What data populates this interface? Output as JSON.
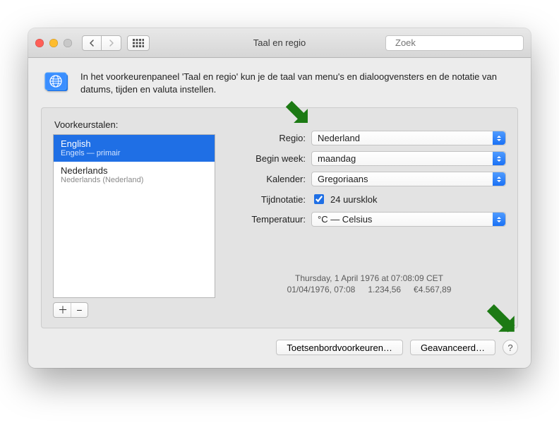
{
  "window": {
    "title": "Taal en regio",
    "search_placeholder": "Zoek"
  },
  "intro": {
    "text": "In het voorkeurenpaneel 'Taal en regio' kun je de taal van menu's en dialoogvensters en de notatie van datums, tijden en valuta instellen."
  },
  "languages": {
    "heading": "Voorkeurstalen:",
    "items": [
      {
        "name": "English",
        "sub": "Engels — primair",
        "selected": true
      },
      {
        "name": "Nederlands",
        "sub": "Nederlands (Nederland)",
        "selected": false
      }
    ]
  },
  "settings": {
    "region": {
      "label": "Regio:",
      "value": "Nederland"
    },
    "weekstart": {
      "label": "Begin week:",
      "value": "maandag"
    },
    "calendar": {
      "label": "Kalender:",
      "value": "Gregoriaans"
    },
    "timefmt": {
      "label": "Tijdnotatie:",
      "checkbox_label": "24 uursklok",
      "checked": true
    },
    "temperature": {
      "label": "Temperatuur:",
      "value": "°C — Celsius"
    }
  },
  "sample": {
    "long": "Thursday, 1 April 1976 at 07:08:09 CET",
    "short": "01/04/1976, 07:08",
    "num": "1.234,56",
    "cur": "€4.567,89"
  },
  "footer": {
    "keyboard": "Toetsenbordvoorkeuren…",
    "advanced": "Geavanceerd…"
  }
}
